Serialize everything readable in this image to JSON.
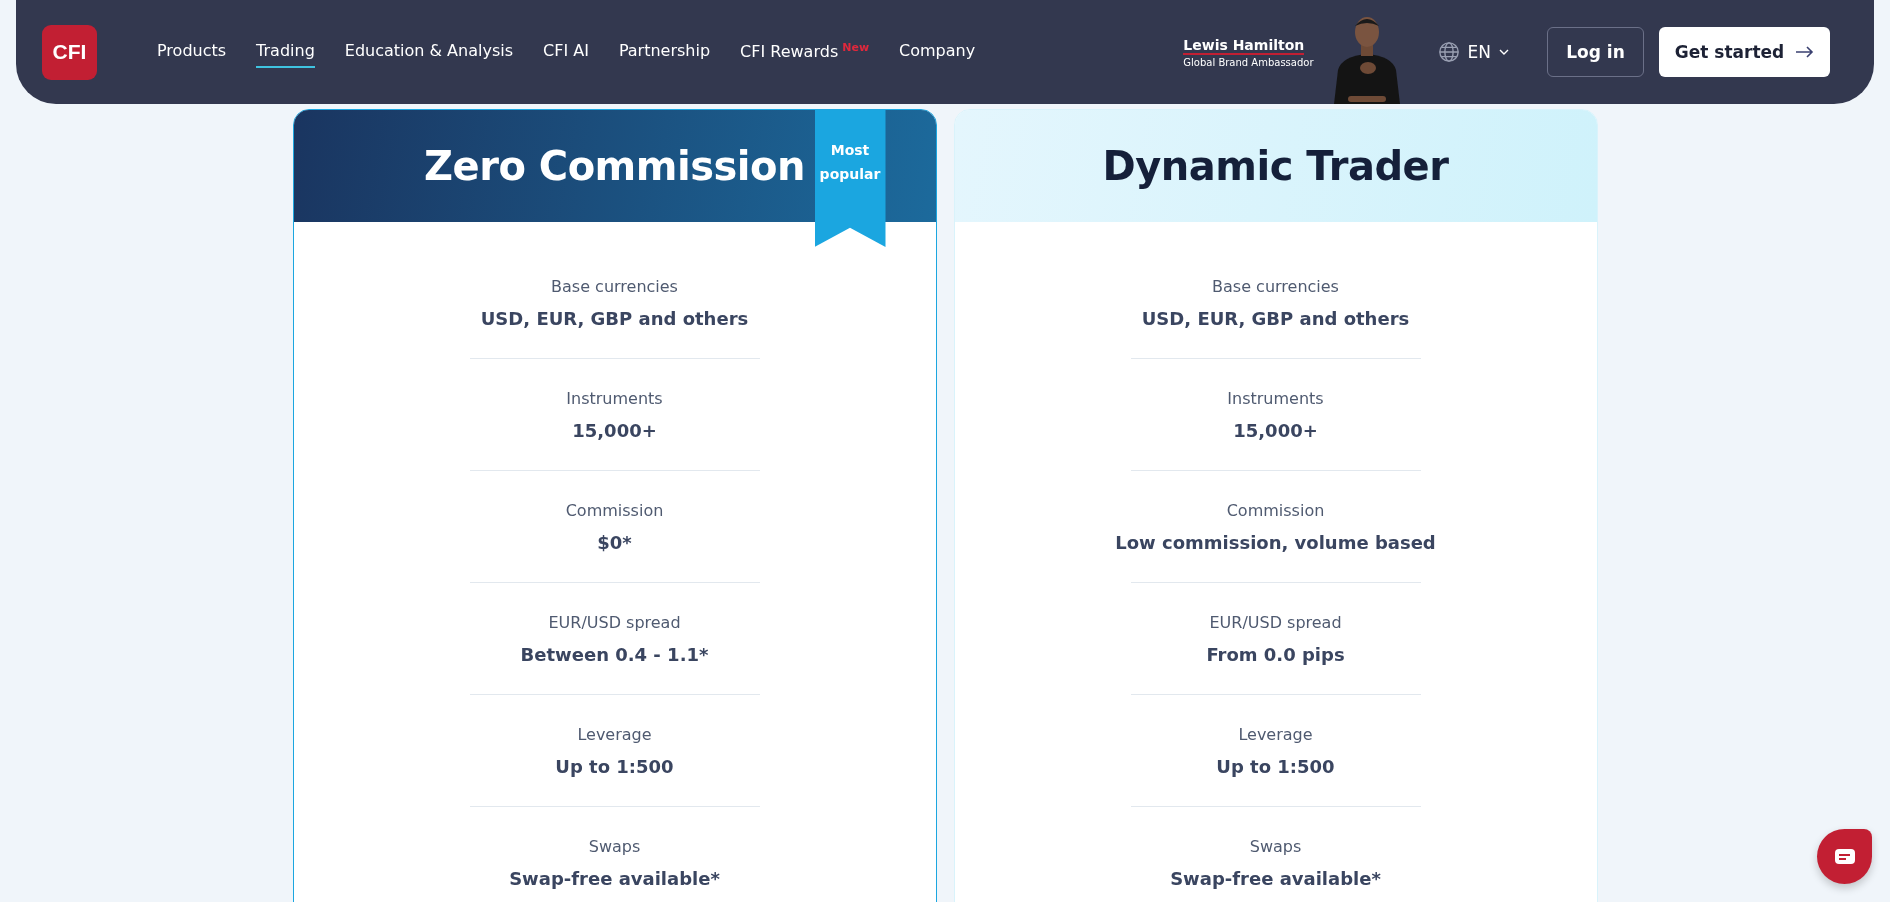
{
  "logo": {
    "text": "CFI"
  },
  "nav": [
    {
      "label": "Products",
      "selected": false
    },
    {
      "label": "Trading",
      "selected": true
    },
    {
      "label": "Education & Analysis",
      "selected": false
    },
    {
      "label": "CFI AI",
      "selected": false
    },
    {
      "label": "Partnership",
      "selected": false
    },
    {
      "label": "CFI Rewards",
      "selected": false,
      "badge": "New"
    },
    {
      "label": "Company",
      "selected": false
    }
  ],
  "ambassador": {
    "name": "Lewis Hamilton",
    "role": "Global Brand Ambassador"
  },
  "language": {
    "label": "EN"
  },
  "buttons": {
    "login": "Log in",
    "get_started": "Get started"
  },
  "plans": [
    {
      "title": "Zero Commission",
      "kind": "featured",
      "ribbon": "Most popular",
      "features": [
        {
          "label": "Base currencies",
          "value": "USD, EUR, GBP and others"
        },
        {
          "label": "Instruments",
          "value": "15,000+"
        },
        {
          "label": "Commission",
          "value": "$0*"
        },
        {
          "label": "EUR/USD spread",
          "value": "Between 0.4 - 1.1*"
        },
        {
          "label": "Leverage",
          "value": "Up to 1:500"
        },
        {
          "label": "Swaps",
          "value": "Swap-free available*"
        }
      ]
    },
    {
      "title": "Dynamic Trader",
      "kind": "standard",
      "features": [
        {
          "label": "Base currencies",
          "value": "USD, EUR, GBP and others"
        },
        {
          "label": "Instruments",
          "value": "15,000+"
        },
        {
          "label": "Commission",
          "value": "Low commission, volume based"
        },
        {
          "label": "EUR/USD spread",
          "value": "From 0.0 pips"
        },
        {
          "label": "Leverage",
          "value": "Up to 1:500"
        },
        {
          "label": "Swaps",
          "value": "Swap-free available*"
        }
      ]
    }
  ]
}
